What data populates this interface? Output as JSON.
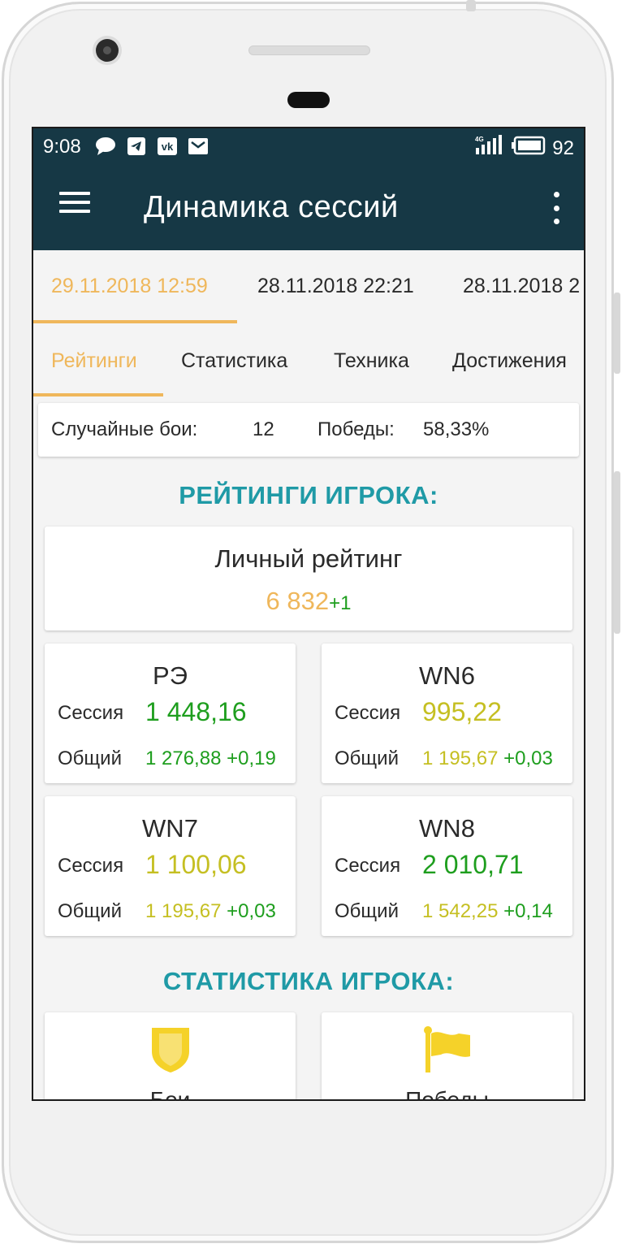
{
  "status_bar": {
    "time": "9:08",
    "network": "4G",
    "battery": "92",
    "icons": [
      "chat-bubble-icon",
      "telegram-icon",
      "vk-icon",
      "mail-icon"
    ]
  },
  "toolbar": {
    "title": "Динамика сессий",
    "menu_icon": "hamburger-menu-icon",
    "overflow_icon": "more-vert-icon"
  },
  "date_tabs": [
    "29.11.2018 12:59",
    "28.11.2018 22:21",
    "28.11.2018 2"
  ],
  "sub_tabs": [
    "Рейтинги",
    "Статистика",
    "Техника",
    "Достижения"
  ],
  "summary": {
    "battles_label": "Случайные бои:",
    "battles_value": "12",
    "wins_label": "Победы:",
    "wins_value": "58,33%"
  },
  "ratings_section_title": "РЕЙТИНГИ ИГРОКА:",
  "personal_rating": {
    "title": "Личный рейтинг",
    "value": "6 832",
    "delta": "+1"
  },
  "rating_cards": [
    {
      "name": "РЭ",
      "session_label": "Сессия",
      "session_value": "1 448,16",
      "session_color": "green",
      "total_label": "Общий",
      "total_value": "1 276,88",
      "total_color": "green",
      "total_delta": "+0,19"
    },
    {
      "name": "WN6",
      "session_label": "Сессия",
      "session_value": "995,22",
      "session_color": "yellow",
      "total_label": "Общий",
      "total_value": "1 195,67",
      "total_color": "yellow",
      "total_delta": "+0,03"
    },
    {
      "name": "WN7",
      "session_label": "Сессия",
      "session_value": "1 100,06",
      "session_color": "yellow",
      "total_label": "Общий",
      "total_value": "1 195,67",
      "total_color": "yellow",
      "total_delta": "+0,03"
    },
    {
      "name": "WN8",
      "session_label": "Сессия",
      "session_value": "2 010,71",
      "session_color": "green",
      "total_label": "Общий",
      "total_value": "1 542,25",
      "total_color": "yellow",
      "total_delta": "+0,14"
    }
  ],
  "stats_section_title": "СТАТИСТИКА ИГРОКА:",
  "stat_cards": [
    {
      "label": "Бои",
      "icon": "shield-icon"
    },
    {
      "label": "Победы",
      "icon": "flag-icon"
    }
  ],
  "colors": {
    "toolbar": "#163845",
    "accent": "#efb75b",
    "section_title": "#1f9aa6",
    "green": "#1e9e1e",
    "yellow": "#c5bf22",
    "icon_yellow": "#f5d229"
  }
}
